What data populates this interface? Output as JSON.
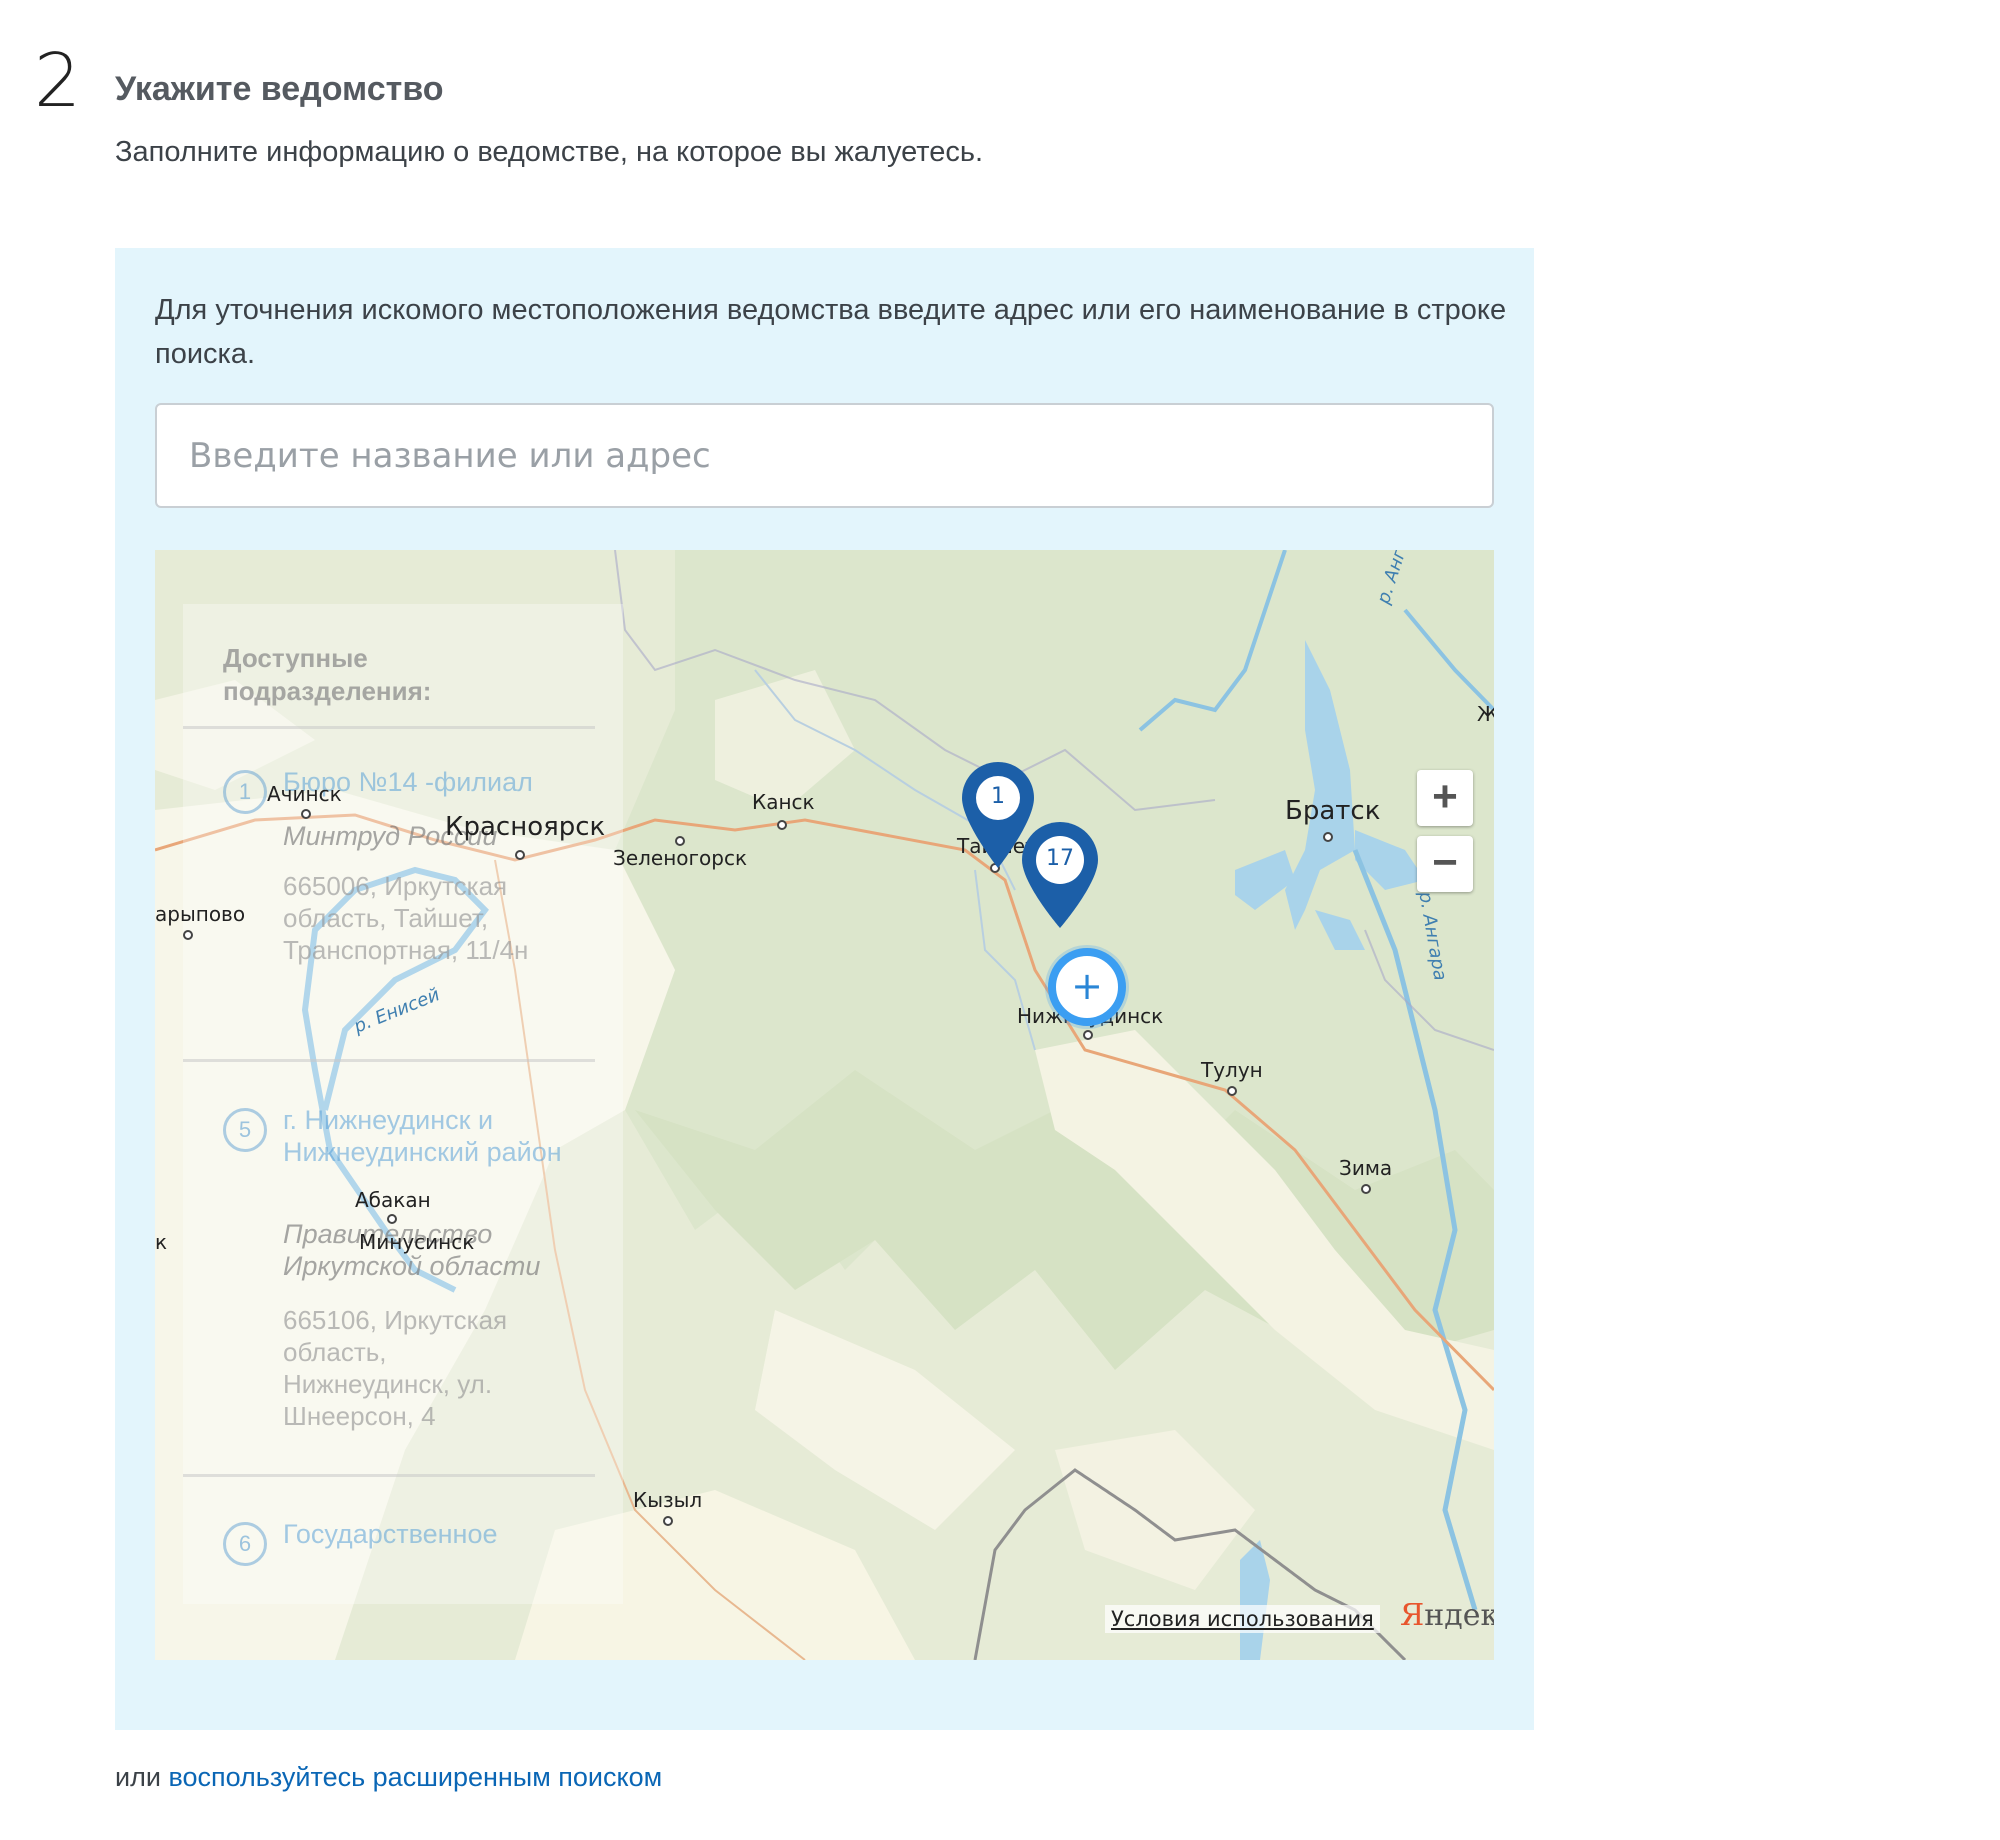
{
  "step": {
    "number": "2",
    "title": "Укажите ведомство",
    "description": "Заполните информацию о ведомстве, на которое вы жалуетесь."
  },
  "panel": {
    "hint": "Для уточнения искомого местоположения ведомства введите адрес или его наименование в строке поиска.",
    "search_placeholder": "Введите название или адрес"
  },
  "map": {
    "cities": {
      "achinsk": "Ачинск",
      "krasnoyarsk": "Красноярск",
      "zelenogorsk": "Зеленогорск",
      "kansk": "Канск",
      "taishet": "Тайшет",
      "bratsk": "Братск",
      "nizhneudinsk": "Нижнеудинск",
      "tulun": "Тулун",
      "zima": "Зима",
      "abakan": "Абакан",
      "minusinsk": "Минусинск",
      "kyzyl": "Кызыл",
      "sharypovo": "арыпово",
      "zh": "Ж",
      "k": "к"
    },
    "rivers": {
      "angara_1": "р. Ангара",
      "angara_2": "р. Ангара",
      "yenisei": "р. Енисей"
    },
    "markers": {
      "taishet_count": "1",
      "nizhneudinsk_count": "17"
    },
    "locate_symbol": "+",
    "zoom_in": "+",
    "zoom_out": "−",
    "terms": "Условия использования",
    "brand_first": "Я",
    "brand_rest": "ндекс",
    "overlay": {
      "title": "Доступные подразделения:",
      "items": [
        {
          "num": "1",
          "name": "Бюро №14 -филиал",
          "org": "Минтруд России",
          "address": "665006, Иркутская область, Тайшет, Транспортная, 11/4н"
        },
        {
          "num": "5",
          "name": "г. Нижнеудинск и Нижнеудинский район",
          "org": "Правительство Иркутской области",
          "address": "665106, Иркутская область, Нижнеудинск, ул. Шнеерсон, 4"
        },
        {
          "num": "6",
          "name": "Государственное",
          "org": "",
          "address": ""
        }
      ]
    }
  },
  "footer": {
    "prefix": "или",
    "link": "воспользуйтесь расширенным поиском"
  },
  "colors": {
    "panel_bg": "#e3f5fc",
    "link": "#0a66b5",
    "marker": "#1c5fa8",
    "locate": "#3b9ef2"
  }
}
